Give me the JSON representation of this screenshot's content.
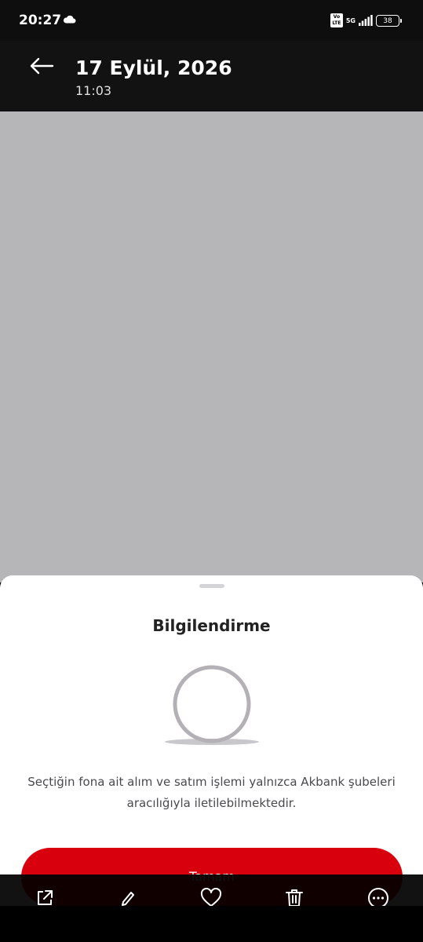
{
  "status_bar": {
    "time": "20:27",
    "volte": "Vo LTE",
    "network": "5G",
    "battery": "38",
    "icons": [
      "cloud-icon",
      "signal-icon",
      "battery-icon"
    ]
  },
  "header": {
    "title": "17 Eylül, 2026",
    "subtitle": "11:03",
    "back_icon": "arrow-left-icon"
  },
  "sheet": {
    "title": "Bilgilendirme",
    "message": "Seçtiğin fona ait alım ve satım işlemi yalnızca Akbank şubeleri aracılığıyla iletilebilmektedir.",
    "button_label": "Tamam",
    "illustration": "ring-illustration"
  },
  "bottom_bar": {
    "items": [
      "share-icon",
      "edit-icon",
      "heart-icon",
      "trash-icon",
      "more-icon"
    ]
  },
  "colors": {
    "accent": "#d9000d",
    "header_bg": "#121212",
    "placeholder_gray": "#b6b6b8"
  }
}
